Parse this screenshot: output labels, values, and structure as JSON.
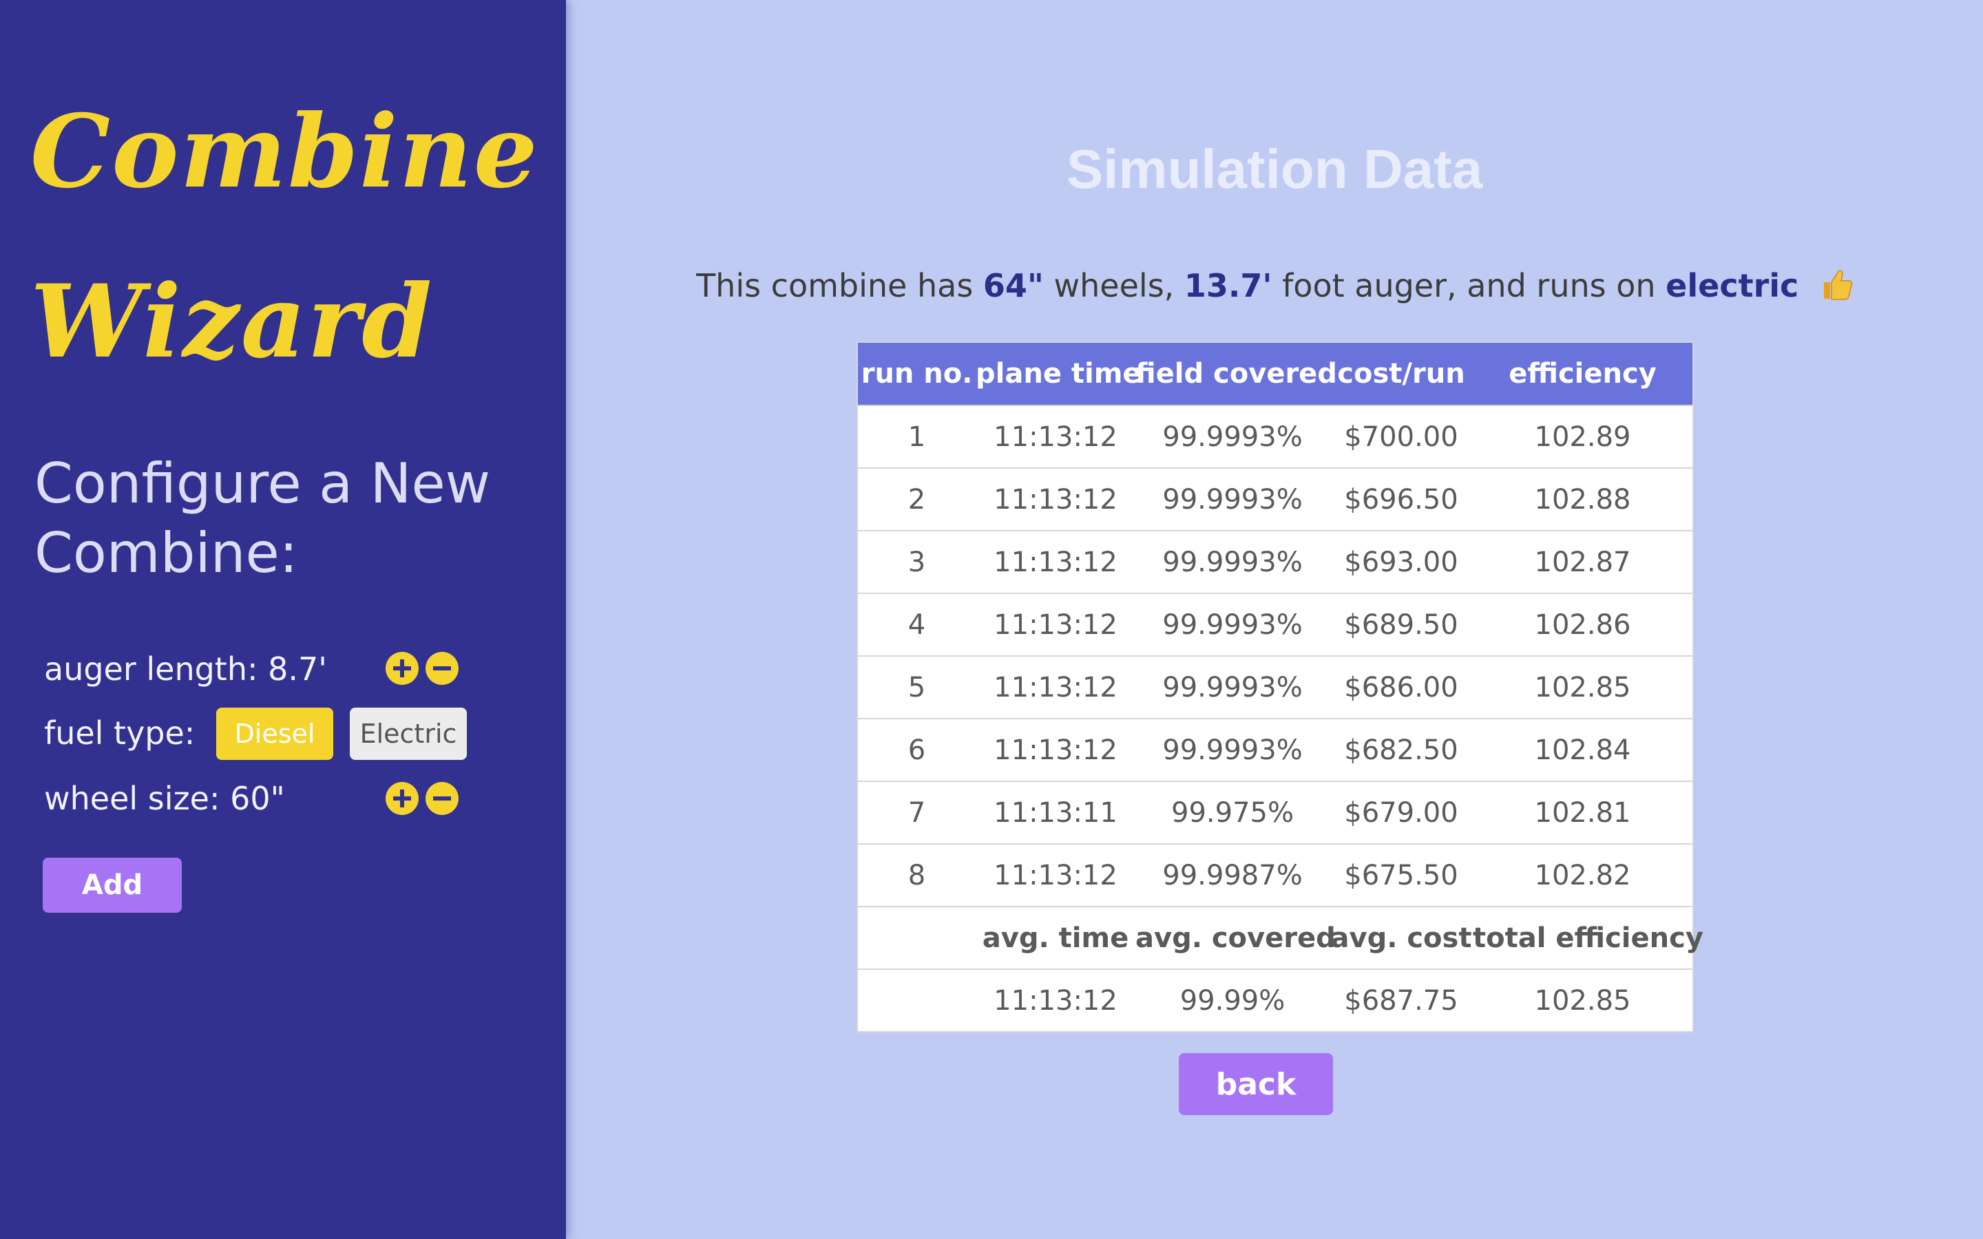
{
  "sidebar": {
    "brand_line_1": "Combine",
    "brand_line_2": "Wizard",
    "configure_heading": "Configure a New Combine:",
    "auger_label": "auger length: 8.7'",
    "fuel_label": "fuel type:",
    "fuel_options": [
      "Diesel",
      "Electric"
    ],
    "fuel_selected": "Diesel",
    "wheel_label": "wheel size: 60\"",
    "add_label": "Add"
  },
  "main": {
    "title": "Simulation Data",
    "summary": {
      "prefix": "This combine has",
      "wheels_value": "64\"",
      "wheels_word": "wheels,",
      "auger_value": "13.7'",
      "auger_word": "foot auger, and runs on",
      "fuel_value": "electric",
      "icon": "thumbs-up-icon"
    },
    "table": {
      "headers": [
        "run no.",
        "plane time",
        "field covered",
        "cost/run",
        "efficiency"
      ],
      "rows": [
        [
          "1",
          "11:13:12",
          "99.9993%",
          "$700.00",
          "102.89"
        ],
        [
          "2",
          "11:13:12",
          "99.9993%",
          "$696.50",
          "102.88"
        ],
        [
          "3",
          "11:13:12",
          "99.9993%",
          "$693.00",
          "102.87"
        ],
        [
          "4",
          "11:13:12",
          "99.9993%",
          "$689.50",
          "102.86"
        ],
        [
          "5",
          "11:13:12",
          "99.9993%",
          "$686.00",
          "102.85"
        ],
        [
          "6",
          "11:13:12",
          "99.9993%",
          "$682.50",
          "102.84"
        ],
        [
          "7",
          "11:13:11",
          "99.975%",
          "$679.00",
          "102.81"
        ],
        [
          "8",
          "11:13:12",
          "99.9987%",
          "$675.50",
          "102.82"
        ]
      ],
      "summary_headers": [
        "",
        "avg. time",
        "avg. covered",
        "avg. cost",
        "total efficiency"
      ],
      "summary_values": [
        "",
        "11:13:12",
        "99.99%",
        "$687.75",
        "102.85"
      ]
    },
    "back_label": "back"
  },
  "colors": {
    "sidebar_bg": "#32318f",
    "main_bg": "#bfcbf3",
    "brand_yellow": "#f5d42e",
    "table_header": "#6a72dc",
    "button_purple": "#a874f6"
  }
}
